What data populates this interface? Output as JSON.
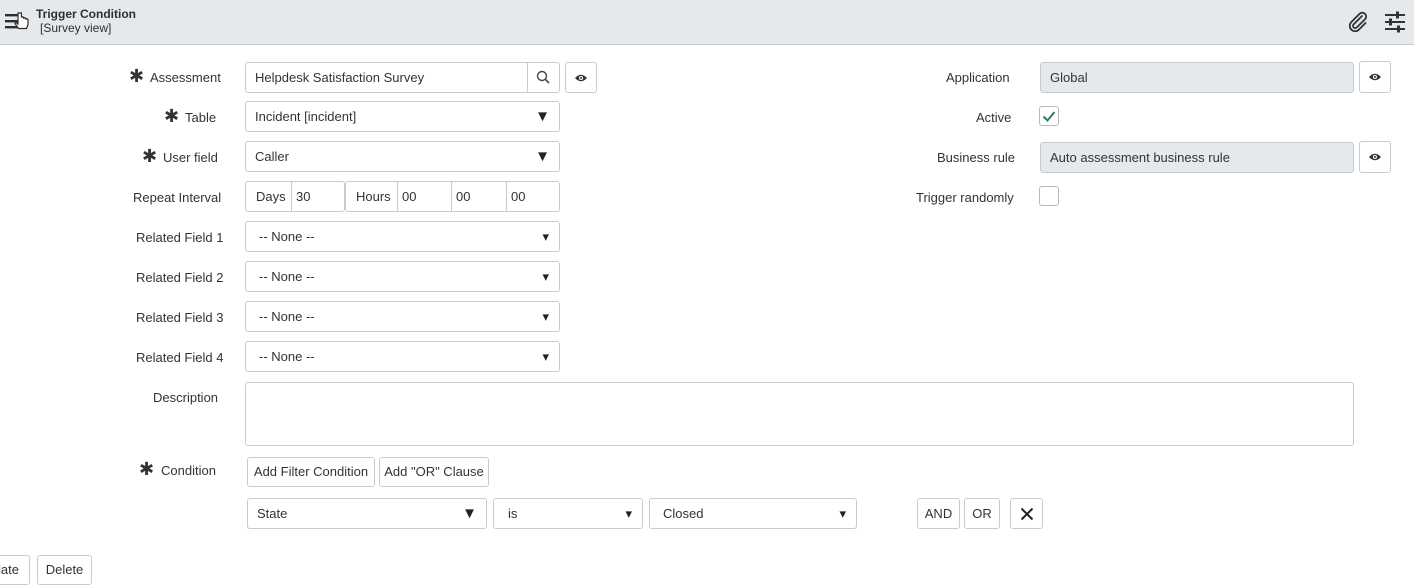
{
  "header": {
    "title": "Trigger Condition",
    "subtitle": "[Survey view]",
    "icons": [
      "menu-icon",
      "paperclip-icon",
      "settings-icon"
    ]
  },
  "form": {
    "assessment": {
      "label": "Assessment",
      "value": "Helpdesk Satisfaction Survey",
      "required": true
    },
    "table": {
      "label": "Table",
      "value": "Incident [incident]",
      "required": true
    },
    "user_field": {
      "label": "User field",
      "value": "Caller",
      "required": true
    },
    "repeat_interval": {
      "label": "Repeat Interval",
      "days_label": "Days",
      "days_value": "30",
      "hours_label": "Hours",
      "hours_value": "00",
      "minutes_value": "00",
      "seconds_value": "00"
    },
    "related_field_1": {
      "label": "Related Field 1",
      "value": "-- None --"
    },
    "related_field_2": {
      "label": "Related Field 2",
      "value": "-- None --"
    },
    "related_field_3": {
      "label": "Related Field 3",
      "value": "-- None --"
    },
    "related_field_4": {
      "label": "Related Field 4",
      "value": "-- None --"
    },
    "description": {
      "label": "Description",
      "value": ""
    },
    "condition": {
      "label": "Condition",
      "required": true,
      "add_filter_label": "Add Filter Condition",
      "add_or_label": "Add \"OR\" Clause",
      "field": "State",
      "operator": "is",
      "value": "Closed",
      "and_label": "AND",
      "or_label": "OR"
    },
    "application": {
      "label": "Application",
      "value": "Global"
    },
    "active": {
      "label": "Active",
      "checked": true
    },
    "business_rule": {
      "label": "Business rule",
      "value": "Auto assessment business rule"
    },
    "trigger_randomly": {
      "label": "Trigger randomly",
      "checked": false
    }
  },
  "footer": {
    "update_label": "Update",
    "delete_label": "Delete"
  },
  "colors": {
    "header_bg": "#e6e9eb",
    "border": "#c8ccd0",
    "readonly_bg": "#e6e9eb",
    "check": "#2e7d5b"
  }
}
